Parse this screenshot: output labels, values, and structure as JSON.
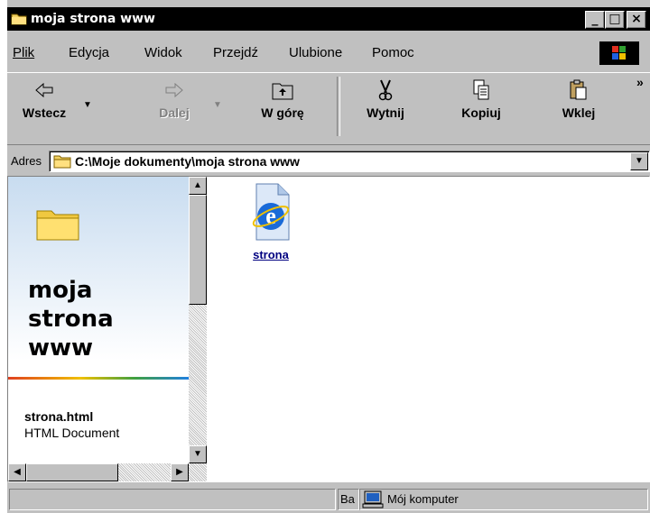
{
  "window": {
    "title": "moja strona www"
  },
  "menu": {
    "items": [
      {
        "label": "Plik"
      },
      {
        "label": "Edycja"
      },
      {
        "label": "Widok"
      },
      {
        "label": "Przejdź"
      },
      {
        "label": "Ulubione"
      },
      {
        "label": "Pomoc"
      }
    ]
  },
  "toolbar": {
    "back": "Wstecz",
    "forward": "Dalej",
    "up": "W górę",
    "cut": "Wytnij",
    "copy": "Kopiuj",
    "paste": "Wklej",
    "more": "»"
  },
  "address": {
    "label": "Adres",
    "value": "C:\\Moje dokumenty\\moja strona www"
  },
  "left_panel": {
    "title_line1": "moja",
    "title_line2": "strona",
    "title_line3": "www",
    "selected_file": "strona.html",
    "selected_type": "HTML Document"
  },
  "files": [
    {
      "label": "strona",
      "icon": "ie-html-file-icon"
    }
  ],
  "status": {
    "section2": "Ba",
    "zone": "Mój komputer"
  },
  "colors": {
    "titlebar": "#000000",
    "face": "#c0c0c0",
    "link": "#000080"
  }
}
